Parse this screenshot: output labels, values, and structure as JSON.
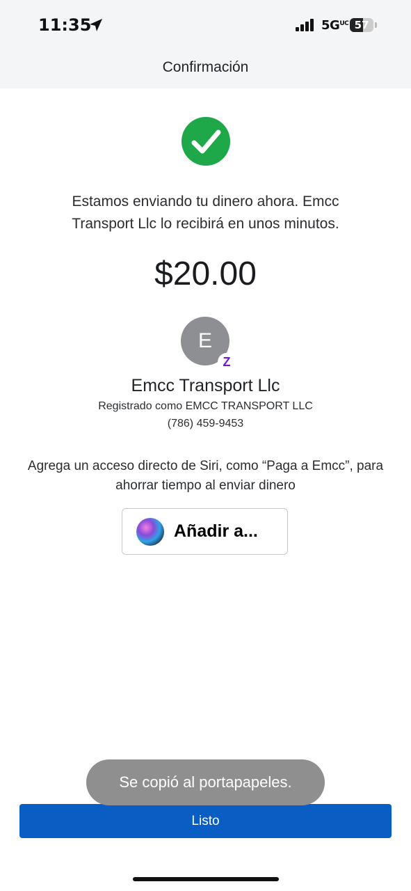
{
  "status_bar": {
    "time": "11:35",
    "network": "5G",
    "network_suffix": "UC",
    "battery": "57",
    "battery_level_percent": 57
  },
  "header": {
    "title": "Confirmación"
  },
  "confirmation": {
    "message": "Estamos enviando tu dinero ahora. Emcc Transport Llc lo recibirá en unos minutos.",
    "amount": "$20.00"
  },
  "recipient": {
    "initial": "E",
    "badge": "Z",
    "name": "Emcc Transport Llc",
    "registered_as": "Registrado como EMCC TRANSPORT LLC",
    "phone": "(786) 459-9453"
  },
  "siri": {
    "prompt": "Agrega un acceso directo de Siri, como “Paga a Emcc”, para ahorrar tiempo al enviar dinero",
    "button_label": "Añadir a..."
  },
  "toast": {
    "text": "Se copió al portapapeles."
  },
  "footer": {
    "done_label": "Listo"
  },
  "colors": {
    "accent": "#0a5ec3",
    "success": "#1ea84a",
    "zelle": "#6d1ed4"
  }
}
